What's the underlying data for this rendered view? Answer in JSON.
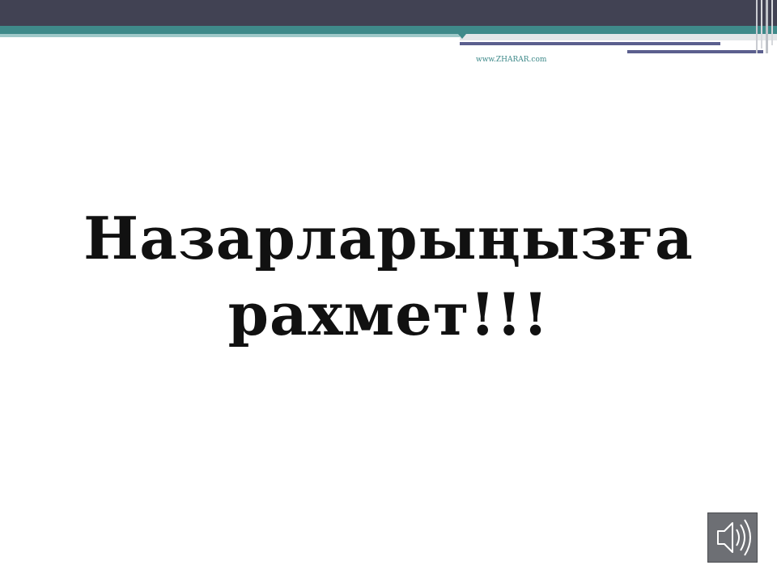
{
  "header": {
    "source_text": "www.ZHARAR.com"
  },
  "main": {
    "thanks_line_1": "Назарларыңызға",
    "thanks_line_2": "рахмет!!!"
  },
  "controls": {
    "sound_icon": "speaker-icon"
  },
  "colors": {
    "top_bar": "#414253",
    "teal_accent": "#3f8a8a",
    "navy_accent": "#5b5f8e",
    "title_text": "#111111",
    "sound_button_bg": "#6d6f74"
  }
}
